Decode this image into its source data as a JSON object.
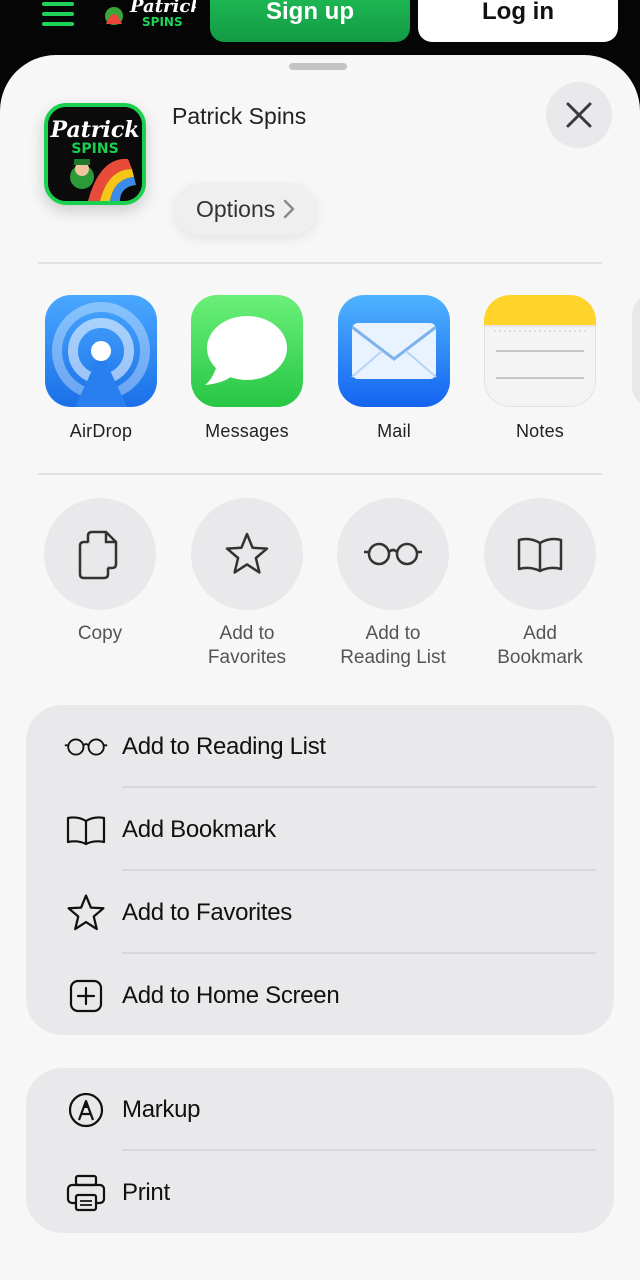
{
  "site": {
    "signup_label": "Sign up",
    "login_label": "Log in",
    "accent": "#1fd35a"
  },
  "sheet": {
    "app_title": "Patrick Spins",
    "options_label": "Options",
    "close_icon": "xmark-icon"
  },
  "apps": [
    {
      "label": "AirDrop",
      "icon": "airdrop-icon"
    },
    {
      "label": "Messages",
      "icon": "messages-icon"
    },
    {
      "label": "Mail",
      "icon": "mail-icon"
    },
    {
      "label": "Notes",
      "icon": "notes-icon"
    }
  ],
  "actions": [
    {
      "label": "Copy",
      "icon": "copy-icon"
    },
    {
      "label": "Add to\nFavorites",
      "icon": "star-icon"
    },
    {
      "label": "Add to\nReading List",
      "icon": "glasses-icon"
    },
    {
      "label": "Add\nBookmark",
      "icon": "book-icon"
    }
  ],
  "list1": [
    {
      "label": "Add to Reading List",
      "icon": "glasses-icon"
    },
    {
      "label": "Add Bookmark",
      "icon": "book-icon"
    },
    {
      "label": "Add to Favorites",
      "icon": "star-icon"
    },
    {
      "label": "Add to Home Screen",
      "icon": "plus-square-icon"
    }
  ],
  "list2": [
    {
      "label": "Markup",
      "icon": "markup-icon"
    },
    {
      "label": "Print",
      "icon": "printer-icon"
    }
  ]
}
